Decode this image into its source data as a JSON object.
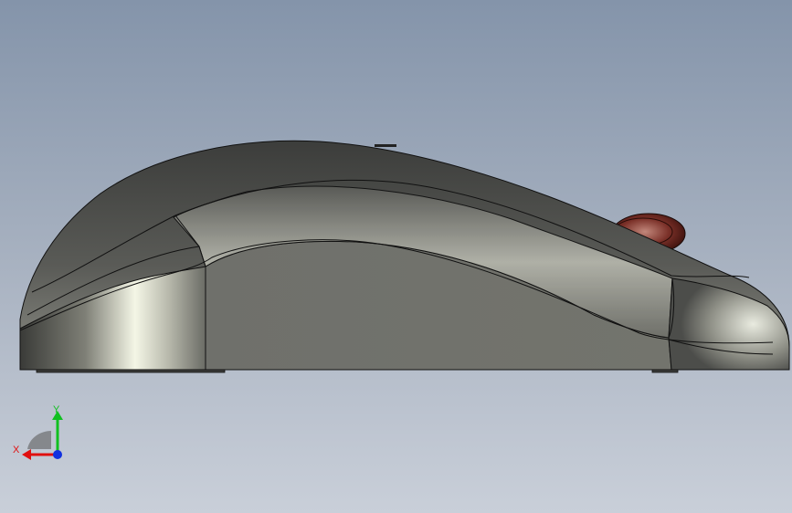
{
  "viewport": {
    "background_top": "#8494aa",
    "background_bottom": "#c9cfd9"
  },
  "model": {
    "part": "mouse-body",
    "body_color": "#6f706b",
    "edge_color": "#111111",
    "wheel_color": "#6a2a24"
  },
  "triad": {
    "x_label": "X",
    "y_label": "Y",
    "x_color": "#e01010",
    "y_color": "#10c020",
    "z_color": "#1030e0"
  }
}
